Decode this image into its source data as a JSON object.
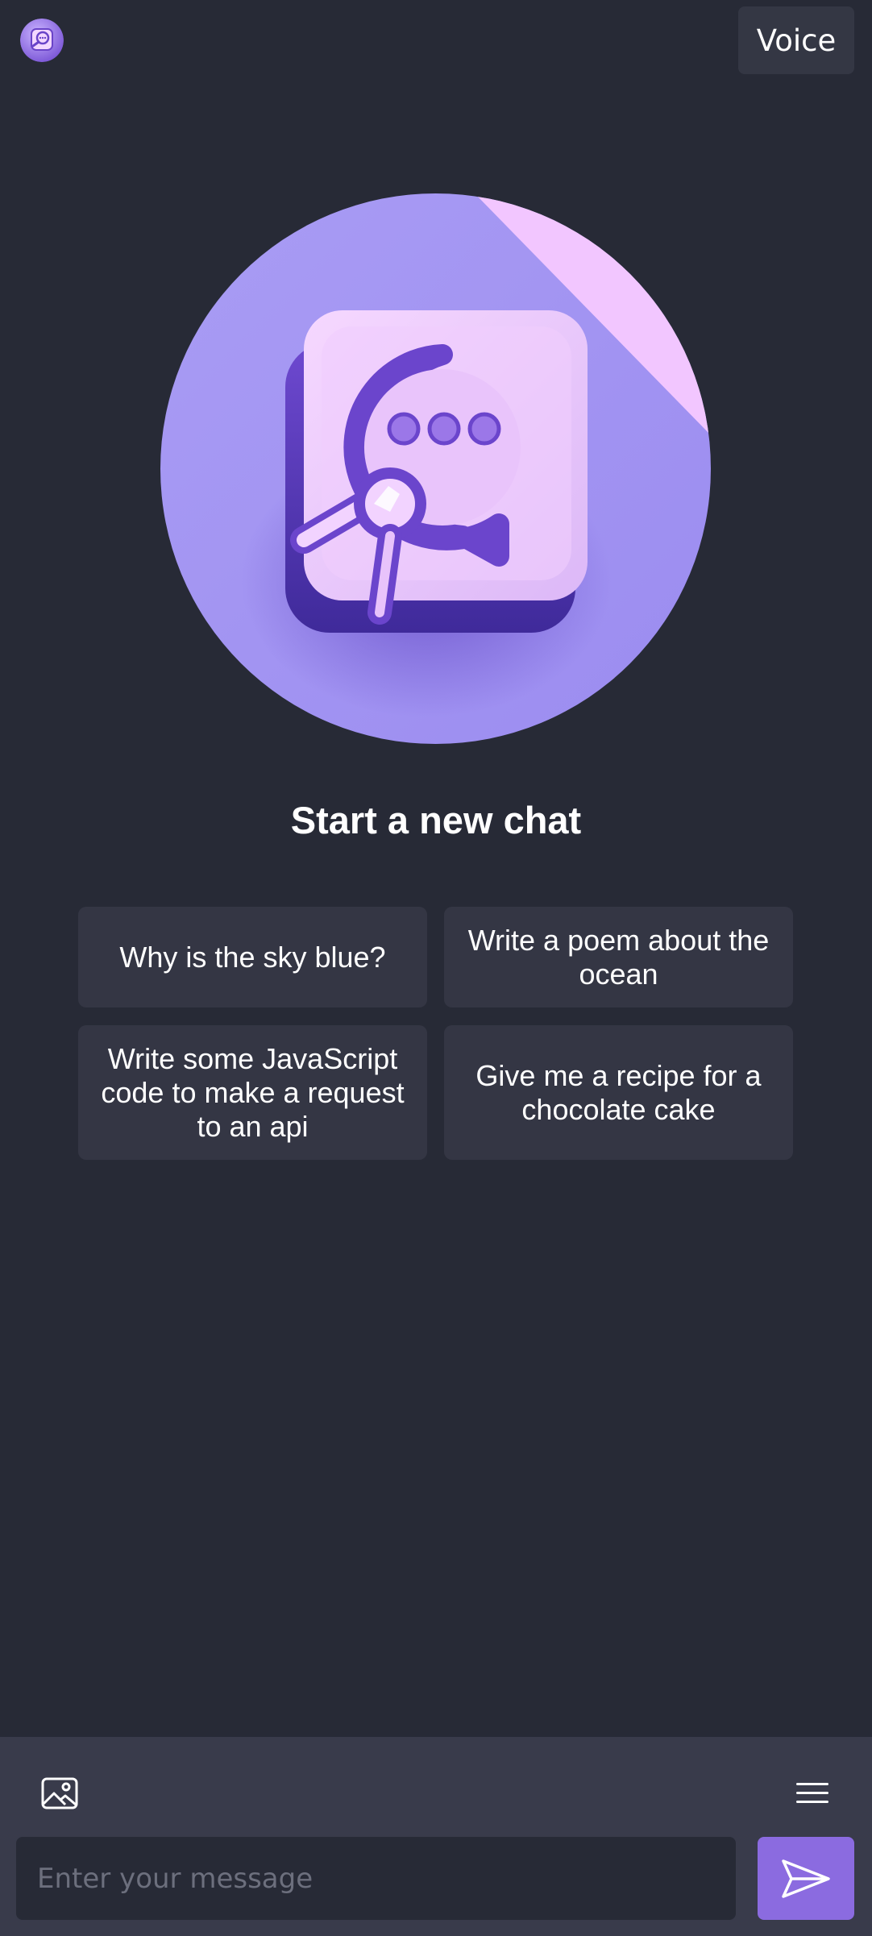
{
  "header": {
    "logo_icon": "chat-logo-icon",
    "voice_label": "Voice"
  },
  "main": {
    "hero_icon": "chat-app-hero-icon",
    "title": "Start a new chat",
    "suggestions": [
      "Why is the sky blue?",
      "Write a poem about the ocean",
      "Write some JavaScript code to make a request to an api",
      "Give me a recipe for a chocolate cake"
    ]
  },
  "composer": {
    "image_icon": "image-icon",
    "menu_icon": "menu-icon",
    "placeholder": "Enter your message",
    "send_icon": "send-icon"
  },
  "colors": {
    "background": "#272a36",
    "card": "#343644",
    "composer": "#393b4b",
    "accent": "#8b6be0"
  }
}
